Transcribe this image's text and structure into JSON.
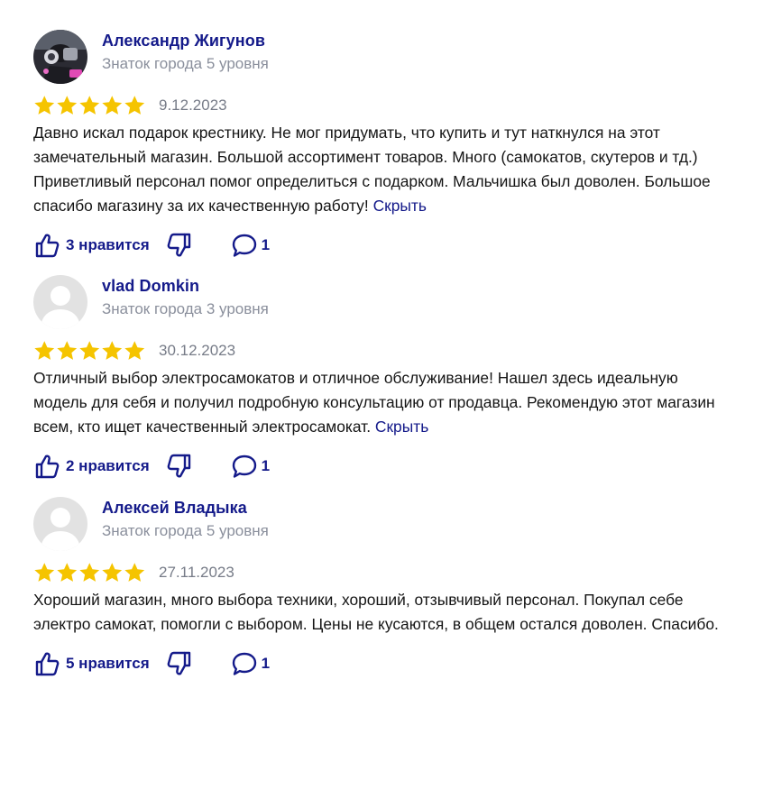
{
  "colors": {
    "accent": "#141a8a",
    "muted": "#8a8f9c",
    "star": "#f5c400",
    "avatar_placeholder": "#e2e2e2"
  },
  "reviews": [
    {
      "author": "Александр Жигунов",
      "level": "Знаток города 5 уровня",
      "rating": 5,
      "date": "9.12.2023",
      "text": "Давно искал подарок крестнику. Не мог придумать, что купить и тут наткнулся на этот замечательный магазин. Большой ассортимент товаров. Много (самокатов, скутеров и тд.) Приветливый персонал помог определиться с подарком. Мальчишка был доволен. Большое спасибо магазину за их качественную работу!",
      "hide_label": "Скрыть",
      "likes_label": "3 нравится",
      "comments": "1",
      "avatar_icon": "photo-avatar"
    },
    {
      "author": "vlad Domkin",
      "level": "Знаток города 3 уровня",
      "rating": 5,
      "date": "30.12.2023",
      "text": "Отличный выбор электросамокатов и отличное обслуживание! Нашел здесь идеальную модель для себя и получил подробную консультацию от продавца. Рекомендую этот магазин всем, кто ищет качественный электросамокат.",
      "hide_label": "Скрыть",
      "likes_label": "2 нравится",
      "comments": "1",
      "avatar_icon": "default-user-avatar"
    },
    {
      "author": "Алексей Владыка",
      "level": "Знаток города 5 уровня",
      "rating": 5,
      "date": "27.11.2023",
      "text": "Хороший магазин, много выбора техники, хороший, отзывчивый персонал. Покупал себе электро самокат, помогли с выбором. Цены не кусаются, в общем остался доволен. Спасибо.",
      "hide_label": "",
      "likes_label": "5 нравится",
      "comments": "1",
      "avatar_icon": "default-user-avatar"
    }
  ]
}
